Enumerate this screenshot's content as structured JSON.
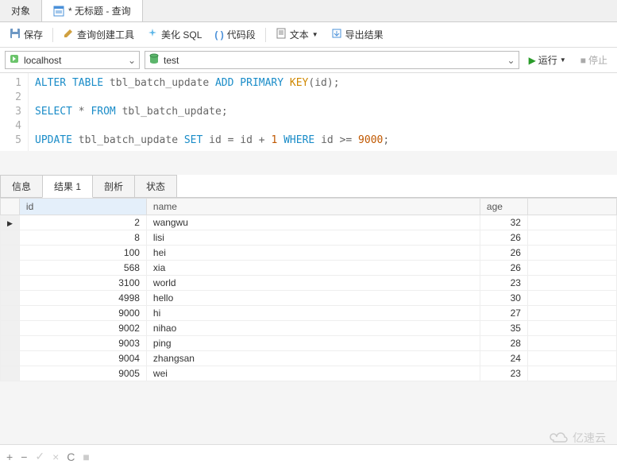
{
  "topTabs": {
    "object": "对象",
    "query": "* 无标题 - 查询"
  },
  "toolbar": {
    "save": "保存",
    "queryBuilder": "查询创建工具",
    "beautify": "美化 SQL",
    "snippet": "代码段",
    "text": "文本",
    "export": "导出结果"
  },
  "conn": {
    "host": "localhost",
    "db": "test",
    "run": "运行",
    "stop": "停止"
  },
  "sql": {
    "lines": [
      "1",
      "2",
      "3",
      "4",
      "5"
    ],
    "l1_seg1": "ALTER TABLE",
    "l1_seg2": "tbl_batch_update",
    "l1_seg3": "ADD PRIMARY",
    "l1_seg4": "KEY",
    "l1_seg5": "(id);",
    "l3_seg1": "SELECT",
    "l3_seg2": "*",
    "l3_seg3": "FROM",
    "l3_seg4": "tbl_batch_update;",
    "l5_seg1": "UPDATE",
    "l5_seg2": "tbl_batch_update",
    "l5_seg3": "SET",
    "l5_seg4": "id",
    "l5_seg5": "=",
    "l5_seg6": "id",
    "l5_seg7": "+",
    "l5_seg8": "1",
    "l5_seg9": "WHERE",
    "l5_seg10": "id",
    "l5_seg11": ">=",
    "l5_seg12": "9000",
    "l5_seg13": ";"
  },
  "resultTabs": {
    "info": "信息",
    "result1": "结果 1",
    "profile": "剖析",
    "status": "状态"
  },
  "columns": {
    "id": "id",
    "name": "name",
    "age": "age"
  },
  "rows": [
    {
      "id": "2",
      "name": "wangwu",
      "age": "32"
    },
    {
      "id": "8",
      "name": "lisi",
      "age": "26"
    },
    {
      "id": "100",
      "name": "hei",
      "age": "26"
    },
    {
      "id": "568",
      "name": "xia",
      "age": "26"
    },
    {
      "id": "3100",
      "name": "world",
      "age": "23"
    },
    {
      "id": "4998",
      "name": "hello",
      "age": "30"
    },
    {
      "id": "9000",
      "name": "hi",
      "age": "27"
    },
    {
      "id": "9002",
      "name": "nihao",
      "age": "35"
    },
    {
      "id": "9003",
      "name": "ping",
      "age": "28"
    },
    {
      "id": "9004",
      "name": "zhangsan",
      "age": "24"
    },
    {
      "id": "9005",
      "name": "wei",
      "age": "23"
    }
  ],
  "watermark": "亿速云",
  "bottomActions": {
    "add": "+",
    "remove": "−",
    "check": "✓",
    "cancel": "×",
    "refresh": "C",
    "stop": "■"
  }
}
